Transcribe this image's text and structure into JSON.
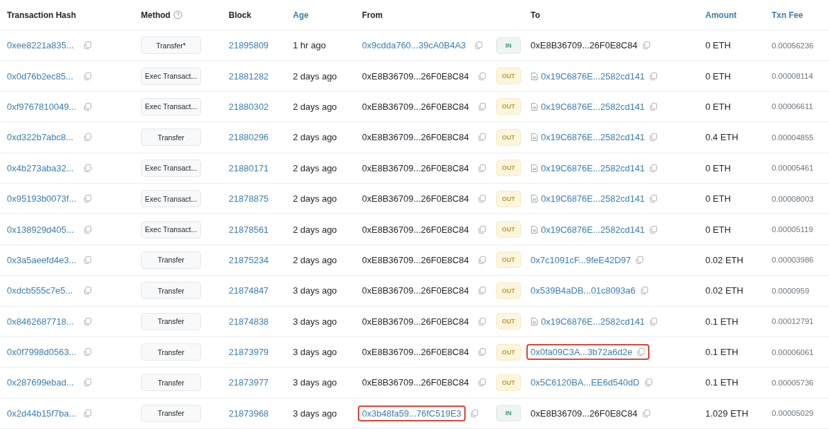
{
  "table": {
    "columns": [
      {
        "label": "Transaction Hash",
        "link": false,
        "help": false
      },
      {
        "label": "Method",
        "link": false,
        "help": true
      },
      {
        "label": "Block",
        "link": false,
        "help": false
      },
      {
        "label": "Age",
        "link": true,
        "help": false
      },
      {
        "label": "From",
        "link": false,
        "help": false
      },
      {
        "label": "To",
        "link": false,
        "help": false
      },
      {
        "label": "Amount",
        "link": true,
        "help": false
      },
      {
        "label": "Txn Fee",
        "link": true,
        "help": false
      }
    ],
    "rows": [
      {
        "hash": "0xee8221a835...",
        "method": "Transfer*",
        "block": "21895809",
        "age": "1 hr ago",
        "from": {
          "text": "0x9cdda760...39cA0B4A3",
          "link": true,
          "highlighted": false
        },
        "direction": "IN",
        "to": {
          "text": "0xE8B36709...26F0E8C84",
          "link": false,
          "contract": false,
          "highlighted": false
        },
        "amount": "0 ETH",
        "fee": "0.00056236"
      },
      {
        "hash": "0x0d76b2ec85...",
        "method": "Exec Transact...",
        "block": "21881282",
        "age": "2 days ago",
        "from": {
          "text": "0xE8B36709...26F0E8C84",
          "link": false,
          "highlighted": false
        },
        "direction": "OUT",
        "to": {
          "text": "0x19C6876E...2582cd141",
          "link": true,
          "contract": true,
          "highlighted": false
        },
        "amount": "0 ETH",
        "fee": "0.00008114"
      },
      {
        "hash": "0xf9767810049...",
        "method": "Exec Transact...",
        "block": "21880302",
        "age": "2 days ago",
        "from": {
          "text": "0xE8B36709...26F0E8C84",
          "link": false,
          "highlighted": false
        },
        "direction": "OUT",
        "to": {
          "text": "0x19C6876E...2582cd141",
          "link": true,
          "contract": true,
          "highlighted": false
        },
        "amount": "0 ETH",
        "fee": "0.00006611"
      },
      {
        "hash": "0xd322b7abc8...",
        "method": "Transfer",
        "block": "21880296",
        "age": "2 days ago",
        "from": {
          "text": "0xE8B36709...26F0E8C84",
          "link": false,
          "highlighted": false
        },
        "direction": "OUT",
        "to": {
          "text": "0x19C6876E...2582cd141",
          "link": true,
          "contract": true,
          "highlighted": false
        },
        "amount": "0.4 ETH",
        "fee": "0.00004855"
      },
      {
        "hash": "0x4b273aba32...",
        "method": "Exec Transact...",
        "block": "21880171",
        "age": "2 days ago",
        "from": {
          "text": "0xE8B36709...26F0E8C84",
          "link": false,
          "highlighted": false
        },
        "direction": "OUT",
        "to": {
          "text": "0x19C6876E...2582cd141",
          "link": true,
          "contract": true,
          "highlighted": false
        },
        "amount": "0 ETH",
        "fee": "0.00005461"
      },
      {
        "hash": "0x95193b0073f...",
        "method": "Exec Transact...",
        "block": "21878875",
        "age": "2 days ago",
        "from": {
          "text": "0xE8B36709...26F0E8C84",
          "link": false,
          "highlighted": false
        },
        "direction": "OUT",
        "to": {
          "text": "0x19C6876E...2582cd141",
          "link": true,
          "contract": true,
          "highlighted": false
        },
        "amount": "0 ETH",
        "fee": "0.00008003"
      },
      {
        "hash": "0x138929d405...",
        "method": "Exec Transact...",
        "block": "21878561",
        "age": "2 days ago",
        "from": {
          "text": "0xE8B36709...26F0E8C84",
          "link": false,
          "highlighted": false
        },
        "direction": "OUT",
        "to": {
          "text": "0x19C6876E...2582cd141",
          "link": true,
          "contract": true,
          "highlighted": false
        },
        "amount": "0 ETH",
        "fee": "0.00005119"
      },
      {
        "hash": "0x3a5aeefd4e3...",
        "method": "Transfer",
        "block": "21875234",
        "age": "2 days ago",
        "from": {
          "text": "0xE8B36709...26F0E8C84",
          "link": false,
          "highlighted": false
        },
        "direction": "OUT",
        "to": {
          "text": "0x7c1091cF...9feE42D97",
          "link": true,
          "contract": false,
          "highlighted": false
        },
        "amount": "0.02 ETH",
        "fee": "0.00003986"
      },
      {
        "hash": "0xdcb555c7e5...",
        "method": "Transfer",
        "block": "21874847",
        "age": "3 days ago",
        "from": {
          "text": "0xE8B36709...26F0E8C84",
          "link": false,
          "highlighted": false
        },
        "direction": "OUT",
        "to": {
          "text": "0x539B4aDB...01c8093a6",
          "link": true,
          "contract": false,
          "highlighted": false
        },
        "amount": "0.02 ETH",
        "fee": "0.0000959"
      },
      {
        "hash": "0x8462687718...",
        "method": "Transfer",
        "block": "21874838",
        "age": "3 days ago",
        "from": {
          "text": "0xE8B36709...26F0E8C84",
          "link": false,
          "highlighted": false
        },
        "direction": "OUT",
        "to": {
          "text": "0x19C6876E...2582cd141",
          "link": true,
          "contract": true,
          "highlighted": false
        },
        "amount": "0.1 ETH",
        "fee": "0.00012791"
      },
      {
        "hash": "0x0f7998d0563...",
        "method": "Transfer",
        "block": "21873979",
        "age": "3 days ago",
        "from": {
          "text": "0xE8B36709...26F0E8C84",
          "link": false,
          "highlighted": false
        },
        "direction": "OUT",
        "to": {
          "text": "0x0fa09C3A...3b72a6d2e",
          "link": true,
          "contract": false,
          "highlighted": true
        },
        "amount": "0.1 ETH",
        "fee": "0.00006061"
      },
      {
        "hash": "0x287699ebad...",
        "method": "Transfer",
        "block": "21873977",
        "age": "3 days ago",
        "from": {
          "text": "0xE8B36709...26F0E8C84",
          "link": false,
          "highlighted": false
        },
        "direction": "OUT",
        "to": {
          "text": "0x5C6120BA...EE6d540dD",
          "link": true,
          "contract": false,
          "highlighted": false
        },
        "amount": "0.1 ETH",
        "fee": "0.00005736"
      },
      {
        "hash": "0x2d44b15f7ba...",
        "method": "Transfer",
        "block": "21873968",
        "age": "3 days ago",
        "from": {
          "text": "0x3b48fa59...76fC519E3",
          "link": true,
          "highlighted": true
        },
        "direction": "IN",
        "to": {
          "text": "0xE8B36709...26F0E8C84",
          "link": false,
          "contract": false,
          "highlighted": false
        },
        "amount": "1.029 ETH",
        "fee": "0.00005029"
      }
    ]
  }
}
